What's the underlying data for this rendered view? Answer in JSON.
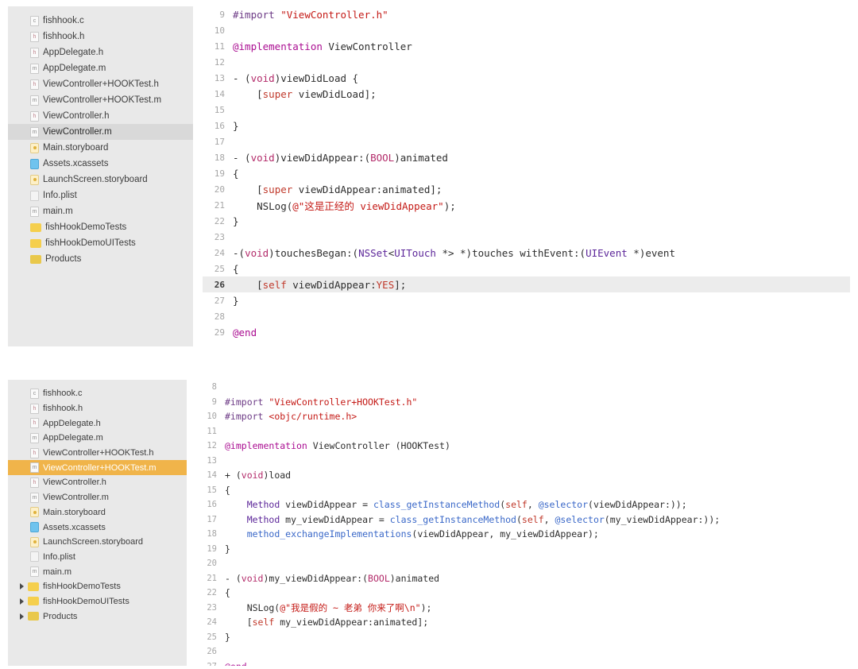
{
  "panels": [
    {
      "id": "panel-top",
      "sidebar": {
        "items": [
          {
            "label": "fishhook.c",
            "icon": "doc-c-icon",
            "icon_letter": "c",
            "icon_type": "doc c",
            "state": "normal",
            "has_triangle": false
          },
          {
            "label": "fishhook.h",
            "icon": "doc-h-icon",
            "icon_letter": "h",
            "icon_type": "doc h",
            "state": "normal",
            "has_triangle": false
          },
          {
            "label": "AppDelegate.h",
            "icon": "doc-h-icon",
            "icon_letter": "h",
            "icon_type": "doc h",
            "state": "normal",
            "has_triangle": false
          },
          {
            "label": "AppDelegate.m",
            "icon": "doc-m-icon",
            "icon_letter": "m",
            "icon_type": "doc m",
            "state": "normal",
            "has_triangle": false
          },
          {
            "label": "ViewController+HOOKTest.h",
            "icon": "doc-h-icon",
            "icon_letter": "h",
            "icon_type": "doc h",
            "state": "normal",
            "has_triangle": false
          },
          {
            "label": "ViewController+HOOKTest.m",
            "icon": "doc-m-icon",
            "icon_letter": "m",
            "icon_type": "doc m",
            "state": "normal",
            "has_triangle": false
          },
          {
            "label": "ViewController.h",
            "icon": "doc-h-icon",
            "icon_letter": "h",
            "icon_type": "doc h",
            "state": "normal",
            "has_triangle": false
          },
          {
            "label": "ViewController.m",
            "icon": "doc-m-icon",
            "icon_letter": "m",
            "icon_type": "doc m",
            "state": "selected-gray",
            "has_triangle": false
          },
          {
            "label": "Main.storyboard",
            "icon": "storyboard-icon",
            "icon_letter": "",
            "icon_type": "story",
            "state": "normal",
            "has_triangle": false
          },
          {
            "label": "Assets.xcassets",
            "icon": "assets-catalog-icon",
            "icon_letter": "",
            "icon_type": "assets",
            "state": "normal",
            "has_triangle": false
          },
          {
            "label": "LaunchScreen.storyboard",
            "icon": "storyboard-icon",
            "icon_letter": "",
            "icon_type": "story",
            "state": "normal",
            "has_triangle": false
          },
          {
            "label": "Info.plist",
            "icon": "plist-icon",
            "icon_letter": "",
            "icon_type": "plist",
            "state": "normal",
            "has_triangle": false
          },
          {
            "label": "main.m",
            "icon": "doc-m-icon",
            "icon_letter": "m",
            "icon_type": "doc m",
            "state": "normal",
            "has_triangle": false
          },
          {
            "label": "fishHookDemoTests",
            "icon": "folder-icon",
            "icon_letter": "",
            "icon_type": "folder",
            "state": "normal",
            "has_triangle": false
          },
          {
            "label": "fishHookDemoUITests",
            "icon": "folder-icon",
            "icon_letter": "",
            "icon_type": "folder",
            "state": "normal",
            "has_triangle": false
          },
          {
            "label": "Products",
            "icon": "folder-icon",
            "icon_letter": "",
            "icon_type": "folder products",
            "state": "normal",
            "has_triangle": false
          }
        ]
      },
      "editor": {
        "highlighted_line": 26,
        "lines": [
          {
            "num": "9",
            "tokens": [
              {
                "t": "#import ",
                "c": "pre"
              },
              {
                "t": "\"ViewController.h\"",
                "c": "str"
              }
            ]
          },
          {
            "num": "10",
            "tokens": []
          },
          {
            "num": "11",
            "tokens": [
              {
                "t": "@implementation",
                "c": "kw"
              },
              {
                "t": " ViewController",
                "c": "plain"
              }
            ]
          },
          {
            "num": "12",
            "tokens": []
          },
          {
            "num": "13",
            "tokens": [
              {
                "t": "- (",
                "c": "plain"
              },
              {
                "t": "void",
                "c": "type"
              },
              {
                "t": ")viewDidLoad {",
                "c": "plain"
              }
            ]
          },
          {
            "num": "14",
            "tokens": [
              {
                "t": "    [",
                "c": "plain"
              },
              {
                "t": "super",
                "c": "self"
              },
              {
                "t": " viewDidLoad];",
                "c": "plain"
              }
            ]
          },
          {
            "num": "15",
            "tokens": []
          },
          {
            "num": "16",
            "tokens": [
              {
                "t": "}",
                "c": "plain"
              }
            ]
          },
          {
            "num": "17",
            "tokens": []
          },
          {
            "num": "18",
            "tokens": [
              {
                "t": "- (",
                "c": "plain"
              },
              {
                "t": "void",
                "c": "type"
              },
              {
                "t": ")viewDidAppear:(",
                "c": "plain"
              },
              {
                "t": "BOOL",
                "c": "type"
              },
              {
                "t": ")animated",
                "c": "plain"
              }
            ]
          },
          {
            "num": "19",
            "tokens": [
              {
                "t": "{",
                "c": "plain"
              }
            ]
          },
          {
            "num": "20",
            "tokens": [
              {
                "t": "    [",
                "c": "plain"
              },
              {
                "t": "super",
                "c": "self"
              },
              {
                "t": " viewDidAppear:animated];",
                "c": "plain"
              }
            ]
          },
          {
            "num": "21",
            "tokens": [
              {
                "t": "    NSLog(",
                "c": "plain"
              },
              {
                "t": "@\"这是正经的 viewDidAppear\"",
                "c": "str"
              },
              {
                "t": ");",
                "c": "plain"
              }
            ]
          },
          {
            "num": "22",
            "tokens": [
              {
                "t": "}",
                "c": "plain"
              }
            ]
          },
          {
            "num": "23",
            "tokens": []
          },
          {
            "num": "24",
            "tokens": [
              {
                "t": "-(",
                "c": "plain"
              },
              {
                "t": "void",
                "c": "type"
              },
              {
                "t": ")touchesBegan:(",
                "c": "plain"
              },
              {
                "t": "NSSet",
                "c": "cls"
              },
              {
                "t": "<",
                "c": "plain"
              },
              {
                "t": "UITouch",
                "c": "cls"
              },
              {
                "t": " *> *)touches withEvent:(",
                "c": "plain"
              },
              {
                "t": "UIEvent",
                "c": "cls"
              },
              {
                "t": " *)event",
                "c": "plain"
              }
            ]
          },
          {
            "num": "25",
            "tokens": [
              {
                "t": "{",
                "c": "plain"
              }
            ]
          },
          {
            "num": "26",
            "tokens": [
              {
                "t": "    [",
                "c": "plain"
              },
              {
                "t": "self",
                "c": "self"
              },
              {
                "t": " viewDidAppear:",
                "c": "plain"
              },
              {
                "t": "YES",
                "c": "self"
              },
              {
                "t": "];",
                "c": "plain"
              }
            ]
          },
          {
            "num": "27",
            "tokens": [
              {
                "t": "}",
                "c": "plain"
              }
            ]
          },
          {
            "num": "28",
            "tokens": []
          },
          {
            "num": "29",
            "tokens": [
              {
                "t": "@end",
                "c": "kw"
              }
            ]
          }
        ]
      }
    },
    {
      "id": "panel-bottom",
      "sidebar": {
        "items": [
          {
            "label": "fishhook.c",
            "icon": "doc-c-icon",
            "icon_letter": "c",
            "icon_type": "doc c",
            "state": "normal",
            "has_triangle": false
          },
          {
            "label": "fishhook.h",
            "icon": "doc-h-icon",
            "icon_letter": "h",
            "icon_type": "doc h",
            "state": "normal",
            "has_triangle": false
          },
          {
            "label": "AppDelegate.h",
            "icon": "doc-h-icon",
            "icon_letter": "h",
            "icon_type": "doc h",
            "state": "normal",
            "has_triangle": false
          },
          {
            "label": "AppDelegate.m",
            "icon": "doc-m-icon",
            "icon_letter": "m",
            "icon_type": "doc m",
            "state": "normal",
            "has_triangle": false
          },
          {
            "label": "ViewController+HOOKTest.h",
            "icon": "doc-h-icon",
            "icon_letter": "h",
            "icon_type": "doc h",
            "state": "normal",
            "has_triangle": false
          },
          {
            "label": "ViewController+HOOKTest.m",
            "icon": "doc-m-icon",
            "icon_letter": "m",
            "icon_type": "doc m",
            "state": "selected-orange",
            "has_triangle": false
          },
          {
            "label": "ViewController.h",
            "icon": "doc-h-icon",
            "icon_letter": "h",
            "icon_type": "doc h",
            "state": "normal",
            "has_triangle": false
          },
          {
            "label": "ViewController.m",
            "icon": "doc-m-icon",
            "icon_letter": "m",
            "icon_type": "doc m",
            "state": "normal",
            "has_triangle": false
          },
          {
            "label": "Main.storyboard",
            "icon": "storyboard-icon",
            "icon_letter": "",
            "icon_type": "story",
            "state": "normal",
            "has_triangle": false
          },
          {
            "label": "Assets.xcassets",
            "icon": "assets-catalog-icon",
            "icon_letter": "",
            "icon_type": "assets",
            "state": "normal",
            "has_triangle": false
          },
          {
            "label": "LaunchScreen.storyboard",
            "icon": "storyboard-icon",
            "icon_letter": "",
            "icon_type": "story",
            "state": "normal",
            "has_triangle": false
          },
          {
            "label": "Info.plist",
            "icon": "plist-icon",
            "icon_letter": "",
            "icon_type": "plist",
            "state": "normal",
            "has_triangle": false
          },
          {
            "label": "main.m",
            "icon": "doc-m-icon",
            "icon_letter": "m",
            "icon_type": "doc m",
            "state": "normal",
            "has_triangle": false
          },
          {
            "label": "fishHookDemoTests",
            "icon": "folder-icon",
            "icon_letter": "",
            "icon_type": "folder",
            "state": "normal",
            "has_triangle": true
          },
          {
            "label": "fishHookDemoUITests",
            "icon": "folder-icon",
            "icon_letter": "",
            "icon_type": "folder",
            "state": "normal",
            "has_triangle": true
          },
          {
            "label": "Products",
            "icon": "folder-icon",
            "icon_letter": "",
            "icon_type": "folder products",
            "state": "normal",
            "has_triangle": true
          }
        ]
      },
      "editor": {
        "highlighted_line": null,
        "lines": [
          {
            "num": "8",
            "tokens": []
          },
          {
            "num": "9",
            "tokens": [
              {
                "t": "#import ",
                "c": "pre"
              },
              {
                "t": "\"ViewController+HOOKTest.h\"",
                "c": "str"
              }
            ]
          },
          {
            "num": "10",
            "tokens": [
              {
                "t": "#import ",
                "c": "pre"
              },
              {
                "t": "<objc/runtime.h>",
                "c": "str"
              }
            ]
          },
          {
            "num": "11",
            "tokens": []
          },
          {
            "num": "12",
            "tokens": [
              {
                "t": "@implementation",
                "c": "kw"
              },
              {
                "t": " ViewController (HOOKTest)",
                "c": "plain"
              }
            ]
          },
          {
            "num": "13",
            "tokens": []
          },
          {
            "num": "14",
            "tokens": [
              {
                "t": "+ (",
                "c": "plain"
              },
              {
                "t": "void",
                "c": "type"
              },
              {
                "t": ")load",
                "c": "plain"
              }
            ]
          },
          {
            "num": "15",
            "tokens": [
              {
                "t": "{",
                "c": "plain"
              }
            ]
          },
          {
            "num": "16",
            "tokens": [
              {
                "t": "    ",
                "c": "plain"
              },
              {
                "t": "Method",
                "c": "cls"
              },
              {
                "t": " viewDidAppear = ",
                "c": "plain"
              },
              {
                "t": "class_getInstanceMethod",
                "c": "call"
              },
              {
                "t": "(",
                "c": "plain"
              },
              {
                "t": "self",
                "c": "self"
              },
              {
                "t": ", ",
                "c": "plain"
              },
              {
                "t": "@selector",
                "c": "call"
              },
              {
                "t": "(viewDidAppear:));",
                "c": "plain"
              }
            ]
          },
          {
            "num": "17",
            "tokens": [
              {
                "t": "    ",
                "c": "plain"
              },
              {
                "t": "Method",
                "c": "cls"
              },
              {
                "t": " my_viewDidAppear = ",
                "c": "plain"
              },
              {
                "t": "class_getInstanceMethod",
                "c": "call"
              },
              {
                "t": "(",
                "c": "plain"
              },
              {
                "t": "self",
                "c": "self"
              },
              {
                "t": ", ",
                "c": "plain"
              },
              {
                "t": "@selector",
                "c": "call"
              },
              {
                "t": "(my_viewDidAppear:));",
                "c": "plain"
              }
            ]
          },
          {
            "num": "18",
            "tokens": [
              {
                "t": "    ",
                "c": "plain"
              },
              {
                "t": "method_exchangeImplementations",
                "c": "call"
              },
              {
                "t": "(viewDidAppear, my_viewDidAppear);",
                "c": "plain"
              }
            ]
          },
          {
            "num": "19",
            "tokens": [
              {
                "t": "}",
                "c": "plain"
              }
            ]
          },
          {
            "num": "20",
            "tokens": []
          },
          {
            "num": "21",
            "tokens": [
              {
                "t": "- (",
                "c": "plain"
              },
              {
                "t": "void",
                "c": "type"
              },
              {
                "t": ")my_viewDidAppear:(",
                "c": "plain"
              },
              {
                "t": "BOOL",
                "c": "type"
              },
              {
                "t": ")animated",
                "c": "plain"
              }
            ]
          },
          {
            "num": "22",
            "tokens": [
              {
                "t": "{",
                "c": "plain"
              }
            ]
          },
          {
            "num": "23",
            "tokens": [
              {
                "t": "    NSLog(",
                "c": "plain"
              },
              {
                "t": "@\"我是假的 ~ 老弟 你来了啊\\n\"",
                "c": "str"
              },
              {
                "t": ");",
                "c": "plain"
              }
            ]
          },
          {
            "num": "24",
            "tokens": [
              {
                "t": "    [",
                "c": "plain"
              },
              {
                "t": "self",
                "c": "self"
              },
              {
                "t": " my_viewDidAppear:animated];",
                "c": "plain"
              }
            ]
          },
          {
            "num": "25",
            "tokens": [
              {
                "t": "}",
                "c": "plain"
              }
            ]
          },
          {
            "num": "26",
            "tokens": []
          },
          {
            "num": "27",
            "tokens": [
              {
                "t": "@end",
                "c": "kw"
              }
            ]
          }
        ]
      }
    }
  ],
  "colors": {
    "sidebar_bg": "#e9e9e9",
    "selected_gray": "#d9d9d9",
    "selected_orange": "#f0b44a",
    "highlight_line": "#ececec",
    "string": "#c41a16",
    "keyword": "#aa0d91",
    "type": "#b32b6a",
    "class": "#5c2699",
    "call": "#3a68c8",
    "self": "#c0392b"
  }
}
